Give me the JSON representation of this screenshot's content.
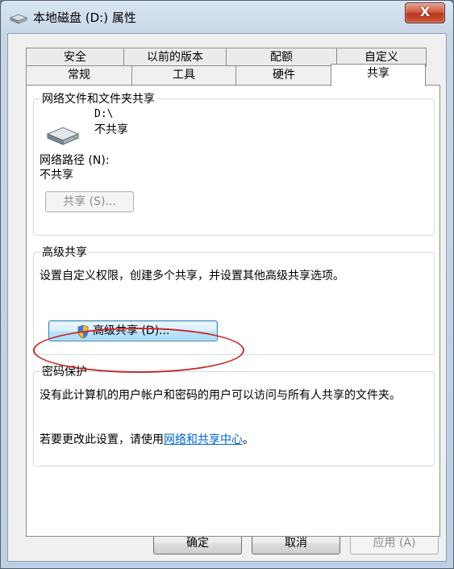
{
  "window": {
    "title": "本地磁盘 (D:) 属性",
    "close_label": "X"
  },
  "tabs": {
    "row1": [
      "安全",
      "以前的版本",
      "配额",
      "自定义"
    ],
    "row2": [
      "常规",
      "工具",
      "硬件",
      "共享"
    ],
    "active": "共享"
  },
  "network_sharing": {
    "legend": "网络文件和文件夹共享",
    "drive_path": "D:\\",
    "drive_status": "不共享",
    "network_path_label": "网络路径 (N):",
    "network_path_value": "不共享",
    "share_button": "共享 (S)..."
  },
  "advanced_sharing": {
    "legend": "高级共享",
    "description": "设置自定义权限，创建多个共享，并设置其他高级共享选项。",
    "button": "高级共享 (D)..."
  },
  "password_protection": {
    "legend": "密码保护",
    "description": "没有此计算机的用户帐户和密码的用户可以访问与所有人共享的文件夹。",
    "change_prefix": "若要更改此设置，请使用",
    "link": "网络和共享中心",
    "change_suffix": "。"
  },
  "footer": {
    "ok": "确定",
    "cancel": "取消",
    "apply": "应用 (A)"
  },
  "icons": {
    "title": "drive-icon",
    "drive": "hard-disk-icon",
    "uac": "uac-shield-icon"
  }
}
